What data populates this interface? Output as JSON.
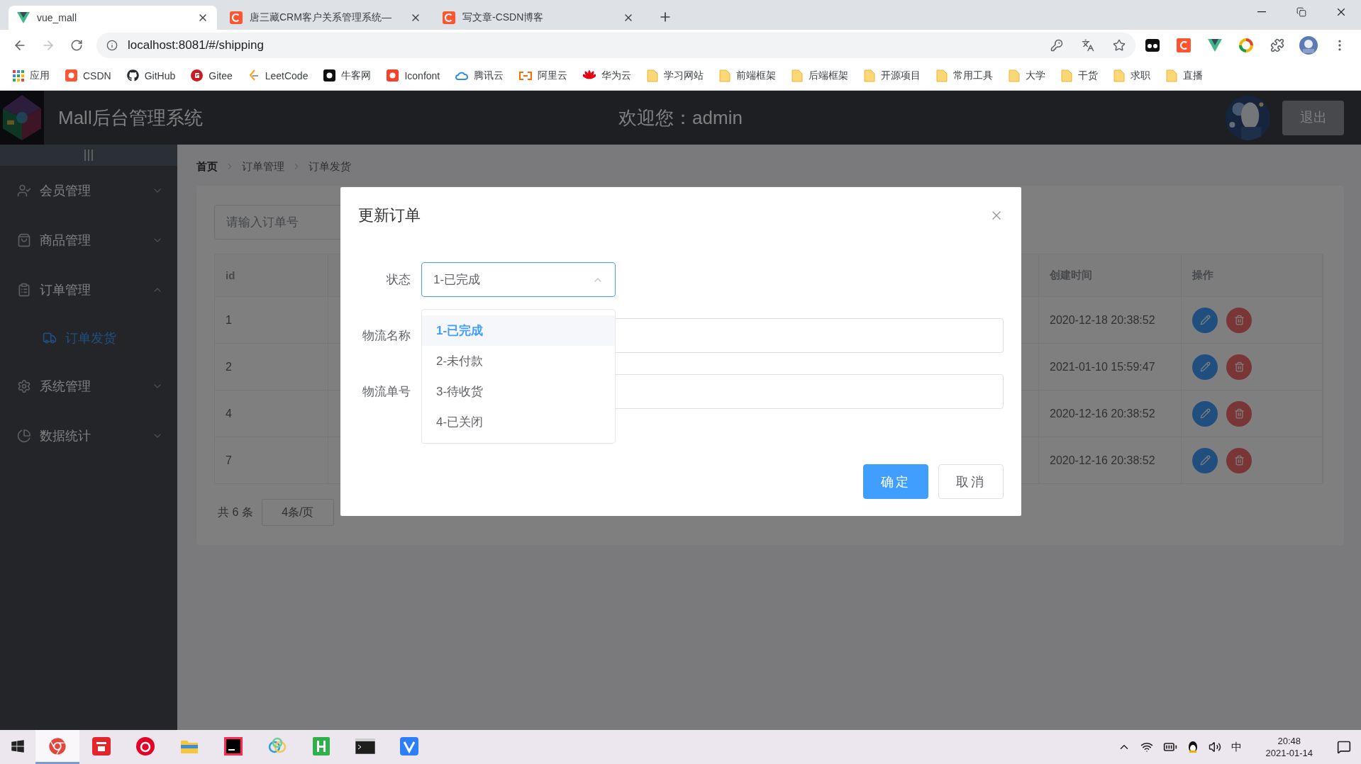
{
  "browser": {
    "tabs": [
      {
        "title": "vue_mall",
        "selected": true
      },
      {
        "title": "唐三藏CRM客户关系管理系统—",
        "selected": false
      },
      {
        "title": "写文章-CSDN博客",
        "selected": false
      }
    ],
    "address": "localhost:8081/#/shipping",
    "bookmarks": [
      {
        "label": "应用"
      },
      {
        "label": "CSDN"
      },
      {
        "label": "GitHub"
      },
      {
        "label": "Gitee"
      },
      {
        "label": "LeetCode"
      },
      {
        "label": "牛客网"
      },
      {
        "label": "Iconfont"
      },
      {
        "label": "腾讯云"
      },
      {
        "label": "阿里云"
      },
      {
        "label": "华为云"
      },
      {
        "label": "学习网站"
      },
      {
        "label": "前端框架"
      },
      {
        "label": "后端框架"
      },
      {
        "label": "开源项目"
      },
      {
        "label": "常用工具"
      },
      {
        "label": "大学"
      },
      {
        "label": "干货"
      },
      {
        "label": "求职"
      },
      {
        "label": "直播"
      }
    ]
  },
  "header": {
    "title": "Mall后台管理系统",
    "welcome": "欢迎您：admin",
    "logout": "退出"
  },
  "sidebar": {
    "items": [
      {
        "label": "会员管理",
        "expanded": false
      },
      {
        "label": "商品管理",
        "expanded": false
      },
      {
        "label": "订单管理",
        "expanded": true,
        "children": [
          {
            "label": "订单发货",
            "selected": true
          }
        ]
      },
      {
        "label": "系统管理",
        "expanded": false
      },
      {
        "label": "数据统计",
        "expanded": false
      }
    ]
  },
  "breadcrumb": [
    {
      "label": "首页",
      "link": true
    },
    {
      "label": "订单管理",
      "link": false
    },
    {
      "label": "订单发货",
      "link": false
    }
  ],
  "search": {
    "placeholder": "请输入订单号"
  },
  "table": {
    "columns": {
      "id": "id",
      "created_at": "创建时间",
      "actions": "操作"
    },
    "rows": [
      {
        "id": "1",
        "created_at": "2020-12-18 20:38:52"
      },
      {
        "id": "2",
        "created_at": "2021-01-10 15:59:47"
      },
      {
        "id": "4",
        "created_at": "2020-12-16 20:38:52"
      },
      {
        "id": "7",
        "created_at": "2020-12-16 20:38:52"
      }
    ]
  },
  "pagination": {
    "total": "共 6 条",
    "page_size": "4条/页"
  },
  "dialog": {
    "title": "更新订单",
    "fields": [
      {
        "label": "状态",
        "kind": "select",
        "value": "1-已完成",
        "open": true
      },
      {
        "label": "物流名称",
        "kind": "input"
      },
      {
        "label": "物流单号",
        "kind": "input"
      }
    ],
    "options": [
      {
        "label": "1-已完成",
        "selected": true
      },
      {
        "label": "2-未付款",
        "selected": false
      },
      {
        "label": "3-待收货",
        "selected": false
      },
      {
        "label": "4-已关闭",
        "selected": false
      }
    ],
    "buttons": [
      {
        "label": "确定",
        "kind": "primary"
      },
      {
        "label": "取消",
        "kind": "default"
      }
    ]
  },
  "taskbar": {
    "apps": [
      {
        "active": true
      },
      {
        "active": false
      },
      {
        "active": false
      },
      {
        "active": false
      },
      {
        "active": false
      },
      {
        "active": false
      },
      {
        "active": false
      },
      {
        "active": false
      },
      {
        "active": false
      }
    ],
    "ime": "中",
    "time": "20:48",
    "date": "2021-01-14"
  }
}
